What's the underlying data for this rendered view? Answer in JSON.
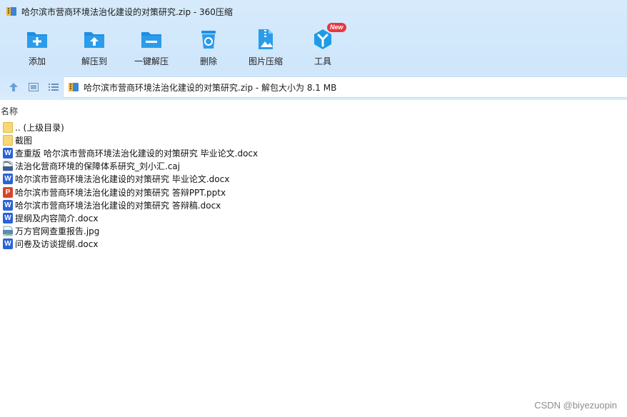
{
  "window": {
    "title": "哈尔滨市营商环境法治化建设的对策研究.zip - 360压缩"
  },
  "toolbar": [
    {
      "label": "添加",
      "icon": "add-folder-icon"
    },
    {
      "label": "解压到",
      "icon": "extract-to-icon"
    },
    {
      "label": "一键解压",
      "icon": "one-click-extract-icon"
    },
    {
      "label": "删除",
      "icon": "recycle-bin-icon"
    },
    {
      "label": "图片压缩",
      "icon": "image-compress-icon"
    },
    {
      "label": "工具",
      "icon": "tools-icon",
      "badge": "New"
    }
  ],
  "address": {
    "text": "哈尔滨市营商环境法治化建设的对策研究.zip - 解包大小为 8.1 MB"
  },
  "list": {
    "column_header": "名称",
    "files": [
      {
        "name": ".. (上级目录)",
        "type": "folder"
      },
      {
        "name": "截图",
        "type": "folder"
      },
      {
        "name": "查重版 哈尔滨市营商环境法治化建设的对策研究 毕业论文.docx",
        "type": "word"
      },
      {
        "name": "法治化营商环境的保障体系研究_刘小汇.caj",
        "type": "caj"
      },
      {
        "name": "哈尔滨市营商环境法治化建设的对策研究 毕业论文.docx",
        "type": "word"
      },
      {
        "name": "哈尔滨市营商环境法治化建设的对策研究 答辩PPT.pptx",
        "type": "ppt"
      },
      {
        "name": "哈尔滨市营商环境法治化建设的对策研究 答辩稿.docx",
        "type": "word"
      },
      {
        "name": "提纲及内容简介.docx",
        "type": "word"
      },
      {
        "name": "万方官网查重报告.jpg",
        "type": "jpg"
      },
      {
        "name": "问卷及访谈提纲.docx",
        "type": "word"
      }
    ]
  },
  "watermark": "CSDN @biyezuopin",
  "colors": {
    "toolbar_bg": "#d6eafb",
    "icon_blue": "#1e8fe0",
    "word_blue": "#2a63d6",
    "ppt_red": "#d9452a",
    "folder_yellow": "#f8d775",
    "badge_red": "#e8363d"
  }
}
